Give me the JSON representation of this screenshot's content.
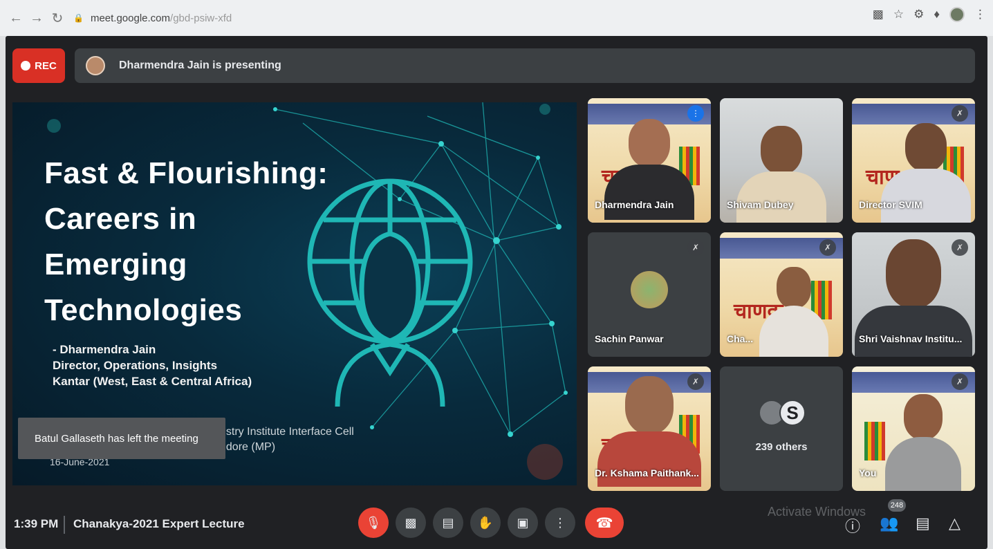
{
  "browser": {
    "url_host": "meet.google.com",
    "url_path": "/gbd-psiw-xfd"
  },
  "meet": {
    "rec_label": "REC",
    "presenting_text": "Dharmendra Jain is presenting",
    "toast": "Batul Gallaseth has left the meeting",
    "slide": {
      "title": "Fast & Flourishing:\nCareers in\nEmerging\nTechnologies",
      "byline": "- Dharmendra Jain\nDirector, Operations, Insights\nKantar (West, East & Central Africa)",
      "iic": "ustry Institute Interface Cell\nndore (MP)",
      "date": "16-June-2021"
    },
    "tiles": [
      {
        "name": "Dharmendra Jain",
        "kind": "banner",
        "active": true
      },
      {
        "name": "Shivam Dubey",
        "kind": "office"
      },
      {
        "name": "Director SVIM",
        "kind": "banner"
      },
      {
        "name": "Sachin Panwar",
        "kind": "avatar"
      },
      {
        "name": "Cha...",
        "kind": "banner"
      },
      {
        "name": "Shri Vaishnav Institu...",
        "kind": "office"
      },
      {
        "name": "Dr. Kshama Paithank...",
        "kind": "banner"
      },
      {
        "name": "",
        "kind": "others",
        "count_label": "239 others"
      },
      {
        "name": "You",
        "kind": "banner"
      }
    ],
    "bottom": {
      "time": "1:39 PM",
      "meeting_title": "Chanakya-2021 Expert Lecture",
      "participants_count": "248"
    },
    "watermark": "Activate Windows"
  },
  "colors": {
    "meet_bg": "#202124",
    "rec_red": "#d93025",
    "leave_red": "#ea4335",
    "slide_teal": "#1fb7b5"
  }
}
